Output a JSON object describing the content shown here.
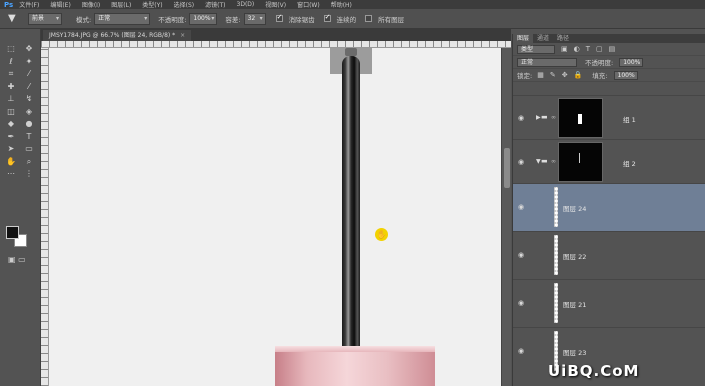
{
  "app": {
    "logo": "Ps"
  },
  "menu": [
    "文件(F)",
    "编辑(E)",
    "图像(I)",
    "图层(L)",
    "类型(Y)",
    "选择(S)",
    "滤镜(T)",
    "3D(D)",
    "视图(V)",
    "窗口(W)",
    "帮助(H)"
  ],
  "options": {
    "preset_value": "前景",
    "mode_label": "模式:",
    "mode_value": "正常",
    "opacity_label": "不透明度:",
    "opacity_value": "100%",
    "tolerance_label": "容差:",
    "tolerance_value": "32",
    "antialias_label": "消除锯齿",
    "contiguous_label": "连续的",
    "all_layers_label": "所有图层"
  },
  "document": {
    "tab_title": "JMSY1784.JPG @ 66.7% (图层 24, RGB/8) *",
    "close": "×"
  },
  "layers_panel": {
    "tabs": [
      "图层",
      "通道",
      "路径"
    ],
    "filter_value": "类型",
    "blend_mode": "正常",
    "opacity_label": "不透明度:",
    "opacity_value": "100%",
    "lock_label": "锁定:",
    "fill_label": "填充:",
    "fill_value": "100%",
    "layers": [
      {
        "name": "组 1",
        "type": "group",
        "collapsed": true
      },
      {
        "name": "组 2",
        "type": "group",
        "collapsed": false
      },
      {
        "name": "图层 24",
        "type": "layer",
        "selected": true
      },
      {
        "name": "图层 22",
        "type": "layer"
      },
      {
        "name": "图层 21",
        "type": "layer"
      },
      {
        "name": "图层 23",
        "type": "layer"
      }
    ]
  },
  "watermark": "UiBQ.CoM",
  "colors": {
    "foreground": "#111111",
    "background": "#ffffff",
    "selection": "#6f7f96"
  }
}
